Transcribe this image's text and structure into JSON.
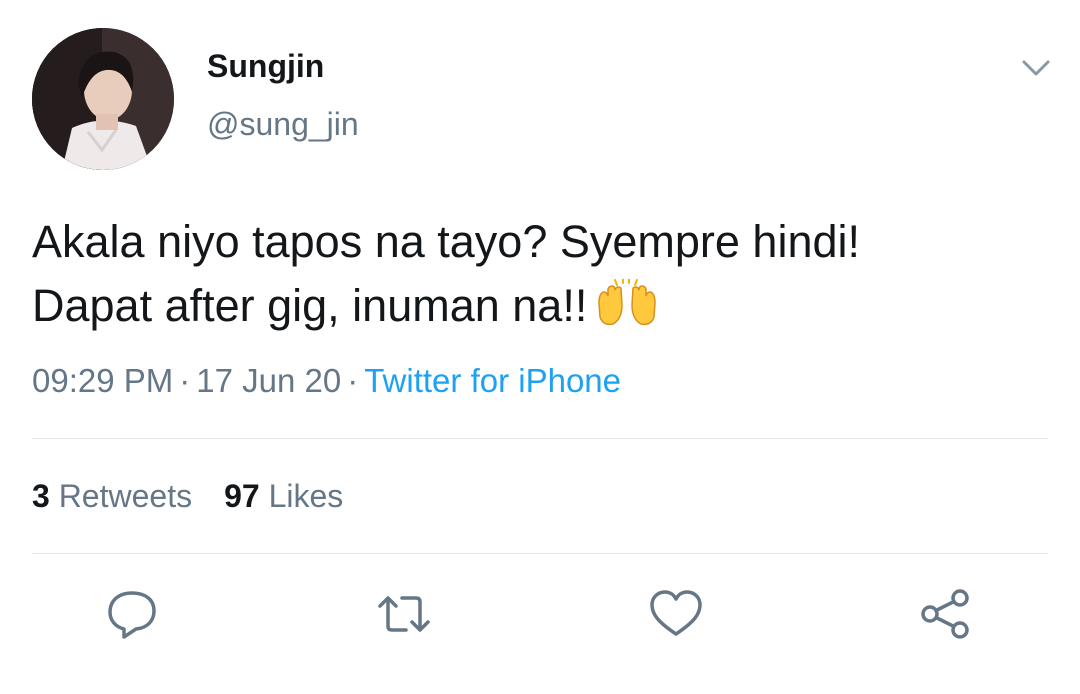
{
  "author": {
    "display_name": "Sungjin",
    "handle": "@sung_jin",
    "avatar_icon": "profile-photo"
  },
  "tweet": {
    "lines": [
      "Akala niyo tapos na tayo? Syempre hindi!",
      "Dapat after gig, inuman na!!"
    ],
    "emoji": "raising-hands-emoji"
  },
  "meta": {
    "time": "09:29 PM",
    "separator": "·",
    "date": "17 Jun 20",
    "source": "Twitter for iPhone"
  },
  "stats": {
    "retweets_count": "3",
    "retweets_label": "Retweets",
    "likes_count": "97",
    "likes_label": "Likes"
  },
  "actions": [
    "reply-icon",
    "retweet-icon",
    "like-icon",
    "share-icon"
  ],
  "colors": {
    "text": "#14171a",
    "secondary": "#657786",
    "link": "#1da1f2",
    "divider": "#e1e8ed"
  }
}
